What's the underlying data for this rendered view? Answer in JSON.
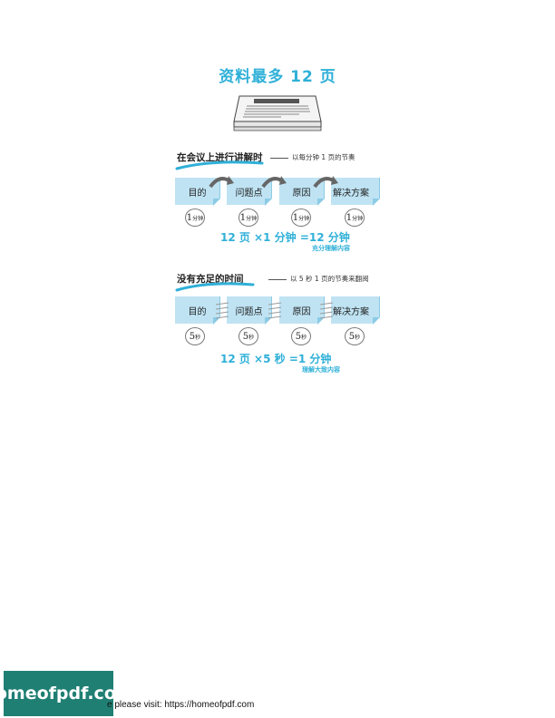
{
  "title": "资料最多 12 页",
  "section1": {
    "heading": "在会议上进行讲解时",
    "note": "以每分钟 1 页的节奏",
    "cards": [
      "目的",
      "问题点",
      "原因",
      "解决方案"
    ],
    "badge_num": "1",
    "badge_unit": "分钟",
    "formula": "12 页 ×1 分钟 =12 分钟",
    "caption": "充分理解内容"
  },
  "section2": {
    "heading": "没有充足的时间",
    "note": "以 5 秒 1 页的节奏来翻阅",
    "cards": [
      "目的",
      "问题点",
      "原因",
      "解决方案"
    ],
    "badge_num": "5",
    "badge_unit": "秒",
    "formula": "12 页 ×5 秒 =1 分钟",
    "caption": "理解大致内容"
  },
  "footer": {
    "logo": "homeofpdf.com",
    "text": "e please visit: https://homeofpdf.com"
  },
  "colors": {
    "accent": "#2fb0d8",
    "card": "#bfe3f3",
    "logo_bg": "#1f7f73"
  }
}
